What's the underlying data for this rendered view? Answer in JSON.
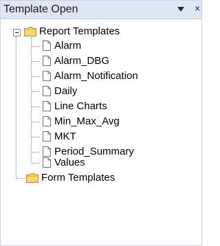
{
  "panel": {
    "title": "Template Open",
    "dropdown_icon": "triangle-down-icon",
    "close_icon": "close-icon",
    "close_glyph": "×"
  },
  "tree": {
    "report_templates": {
      "label": "Report Templates",
      "expanded": true,
      "icon": "folder-icon",
      "children": [
        {
          "label": "Alarm",
          "icon": "document-icon"
        },
        {
          "label": "Alarm_DBG",
          "icon": "document-icon"
        },
        {
          "label": "Alarm_Notification",
          "icon": "document-icon"
        },
        {
          "label": "Daily",
          "icon": "document-icon"
        },
        {
          "label": "Line Charts",
          "icon": "document-icon"
        },
        {
          "label": "Min_Max_Avg",
          "icon": "document-icon"
        },
        {
          "label": "MKT",
          "icon": "document-icon"
        },
        {
          "label": "Period_Summary",
          "icon": "document-icon"
        },
        {
          "label": "Values",
          "icon": "document-icon"
        }
      ]
    },
    "form_templates": {
      "label": "Form Templates",
      "icon": "folder-icon"
    }
  }
}
